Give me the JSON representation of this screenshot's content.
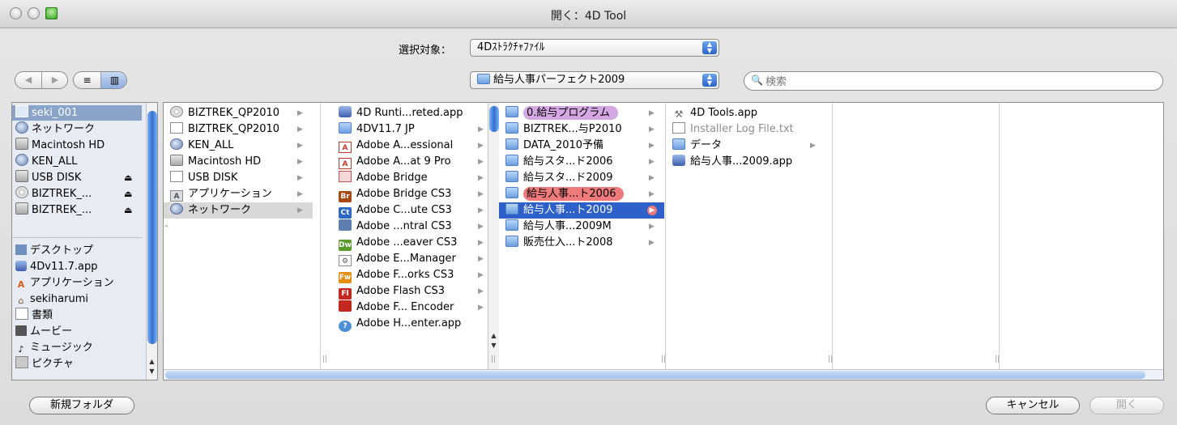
{
  "window": {
    "title": "開く：4D Tool"
  },
  "toolbar": {
    "target_label": "選択対象：",
    "target_value": "4Dｽﾄﾗｸﾁｬﾌｧｲﾙ",
    "location_value": "給与人事パーフェクト2009",
    "search_placeholder": "検索",
    "back_glyph": "◀",
    "forward_glyph": "▶",
    "list_view_glyph": "≡",
    "column_view_glyph": "▥"
  },
  "sidebar": {
    "devices": [
      {
        "label": "seki_001",
        "icon": "computer-icon",
        "selected": true
      },
      {
        "label": "ネットワーク",
        "icon": "network-icon"
      },
      {
        "label": "Macintosh HD",
        "icon": "disk-icon"
      },
      {
        "label": "KEN_ALL",
        "icon": "network-volume-icon"
      },
      {
        "label": "USB DISK",
        "icon": "disk-icon",
        "eject": true
      },
      {
        "label": "BIZTREK_...",
        "icon": "cd-icon",
        "eject": true
      },
      {
        "label": "BIZTREK_...",
        "icon": "disk-icon",
        "eject": true
      }
    ],
    "places": [
      {
        "label": "デスクトップ",
        "icon": "desktop-icon"
      },
      {
        "label": "4Dv11.7.app",
        "icon": "app-icon"
      },
      {
        "label": "アプリケーション",
        "icon": "applications-icon"
      },
      {
        "label": "sekiharumi",
        "icon": "home-icon"
      },
      {
        "label": "書類",
        "icon": "documents-icon"
      },
      {
        "label": "ムービー",
        "icon": "movies-icon"
      },
      {
        "label": "ミュージック",
        "icon": "music-icon"
      },
      {
        "label": "ピクチャ",
        "icon": "pictures-icon"
      }
    ],
    "eject_glyph": "⏏"
  },
  "columns": {
    "col1": [
      "BIZTREK_QP2010",
      "BIZTREK_QP2010",
      "KEN_ALL",
      "Macintosh HD",
      "USB DISK",
      "アプリケーション",
      "ネットワーク"
    ],
    "col2": [
      "4D Runti...reted.app",
      "4DV11.7 JP",
      "Adobe A...essional",
      "Adobe A...at 9 Pro",
      "Adobe Bridge",
      "Adobe Bridge CS3",
      "Adobe C...ute CS3",
      "Adobe ...ntral CS3",
      "Adobe ...eaver CS3",
      "Adobe E...Manager",
      "Adobe F...orks CS3",
      "Adobe Flash CS3",
      "Adobe F... Encoder",
      "Adobe H...enter.app"
    ],
    "col3": [
      "0.給与プログラム",
      "BIZTREK...与P2010",
      "DATA_2010予備",
      "給与スタ...ド2006",
      "給与スタ...ド2009",
      "給与人事...ト2006",
      "給与人事...ト2009",
      "給与人事...2009M",
      "販売仕入...ト2008"
    ],
    "col4": [
      "4D Tools.app",
      "Installer Log File.txt",
      "データ",
      "給与人事...2009.app"
    ],
    "icon_badges": {
      "bridge_cs3": "Br",
      "contribute": "Ct",
      "dreamweaver": "Dw",
      "fireworks": "Fw",
      "flash": "Fl"
    },
    "arrow_glyph": "▶"
  },
  "buttons": {
    "new_folder": "新規フォルダ",
    "cancel": "キャンセル",
    "open": "開く"
  },
  "colors": {
    "selection": "#2d60c9",
    "label_purple": "#d6a8e3",
    "label_red": "#ee7a7c"
  }
}
